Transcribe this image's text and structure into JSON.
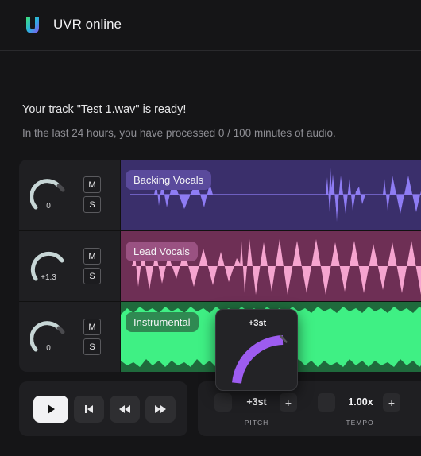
{
  "app": {
    "title": "UVR online",
    "logo_icon": "uvr-logo-icon"
  },
  "status": {
    "ready_text": "Your track \"Test 1.wav\" is ready!",
    "usage_text": "In the last 24 hours, you have processed  0 / 100  minutes of audio."
  },
  "tracks": [
    {
      "name": "Backing Vocals",
      "gain": "0",
      "mute_label": "M",
      "solo_label": "S",
      "lane_color": "#3a2f6b",
      "wave_color": "#8e7cf4",
      "label_bg": "#5a4a9c"
    },
    {
      "name": "Lead Vocals",
      "gain": "+1.3",
      "mute_label": "M",
      "solo_label": "S",
      "lane_color": "#6e2f55",
      "wave_color": "#f5a4cf",
      "label_bg": "#9a5282"
    },
    {
      "name": "Instrumental",
      "gain": "0",
      "mute_label": "M",
      "solo_label": "S",
      "lane_color": "#1f6a3c",
      "wave_color": "#3ff084",
      "label_bg": "#2f8a52"
    }
  ],
  "popover": {
    "value": "+3st",
    "accent": "#9d5cf0"
  },
  "transport": {
    "play_icon": "play-icon",
    "prev_icon": "skip-back-icon",
    "rewind_icon": "rewind-icon",
    "forward_icon": "fast-forward-icon"
  },
  "pitch": {
    "minus": "–",
    "value": "+3st",
    "plus": "+",
    "caption": "PITCH"
  },
  "tempo": {
    "minus": "–",
    "value": "1.00x",
    "plus": "+",
    "caption": "TEMPO"
  }
}
